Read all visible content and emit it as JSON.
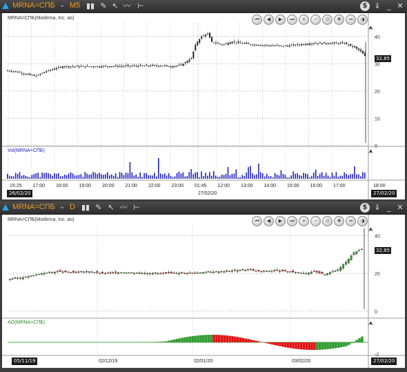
{
  "top_panel": {
    "symbol": "MRNA=СПБ",
    "timeframe": "M5",
    "instrument_label": "MRNA=СПБ(Moderna, Inc. ao)",
    "volume_label": "Vol(MRNA=СПБ)",
    "price_badge": "32,85",
    "start_date": "26/02/20",
    "end_date": "27/02/20"
  },
  "bottom_panel": {
    "symbol": "MRNA=СПБ",
    "timeframe": "D",
    "instrument_label": "MRNA=СПБ(Moderna, Inc. ao)",
    "ao_label": "AO(MRNA=СПБ)",
    "price_badge": "32,85",
    "start_date": "05/11/19",
    "end_date": "27/02/20"
  },
  "icons": {
    "toolbar": [
      "chevron-down-icon",
      "candles-icon",
      "pencil-icon",
      "cursor-icon",
      "lines-icon",
      "settings-icon"
    ],
    "right": [
      "dollar-icon",
      "pin-icon",
      "minimize-icon",
      "close-icon"
    ],
    "nav": [
      "scroll-begin-icon",
      "scroll-back-icon",
      "scroll-forward-icon",
      "scroll-end-icon",
      "zoom-in-icon",
      "zoom-out-icon",
      "zoom-fit-icon",
      "expand-icon",
      "shrink-icon",
      "autoscale-icon"
    ]
  },
  "colors": {
    "accent_title": "#f29a1c",
    "up": "#3a9a3a",
    "down": "#d02818",
    "volume": "#2020c0",
    "ao_line": "#4caf50"
  },
  "chart_data": [
    {
      "type": "candlestick",
      "title": "MRNA=СПБ(Moderna, Inc. ao)",
      "x_ticks": [
        "15:25",
        "17:00",
        "18:00",
        "19:00",
        "20:00",
        "21:00",
        "22:00",
        "23:00",
        "01:45",
        "12:00",
        "13:00",
        "14:00",
        "15:00",
        "16:00",
        "17:00",
        "18:00"
      ],
      "y_ticks": [
        "0",
        "10",
        "20",
        "30",
        "40"
      ],
      "ylim": [
        0,
        45
      ],
      "price_path": [
        [
          0,
          27.5
        ],
        [
          5,
          27
        ],
        [
          10,
          26
        ],
        [
          14,
          25.5
        ],
        [
          18,
          27
        ],
        [
          22,
          28
        ],
        [
          27,
          29
        ],
        [
          30,
          29
        ],
        [
          45,
          29
        ],
        [
          60,
          29.2
        ],
        [
          75,
          29.3
        ],
        [
          80,
          29
        ],
        [
          85,
          29.5
        ],
        [
          90,
          32
        ],
        [
          92,
          37
        ],
        [
          95,
          40
        ],
        [
          98,
          41
        ],
        [
          100,
          38
        ],
        [
          105,
          37
        ],
        [
          110,
          38
        ],
        [
          120,
          37
        ],
        [
          135,
          36.5
        ],
        [
          150,
          37.5
        ],
        [
          165,
          37.5
        ],
        [
          170,
          36
        ],
        [
          173,
          34.5
        ],
        [
          175,
          32.85
        ]
      ],
      "candle_count": 176,
      "last_price": 32.85,
      "grid": true
    },
    {
      "type": "bar",
      "title": "Vol(MRNA=СПБ)",
      "note": "volume bars, random-like heights with spikes near 17:00 and 01:45",
      "bar_count": 176
    },
    {
      "type": "candlestick",
      "title": "MRNA=СПБ(Moderna, Inc. ao)",
      "x_ticks": [
        "02/12/19",
        "02/01/20",
        "03/02/20"
      ],
      "y_ticks": [
        "0",
        "20",
        "40"
      ],
      "ylim": [
        -3,
        46
      ],
      "price_path": [
        [
          0,
          17
        ],
        [
          6,
          18
        ],
        [
          12,
          20
        ],
        [
          18,
          21
        ],
        [
          25,
          20.5
        ],
        [
          30,
          21
        ],
        [
          35,
          20
        ],
        [
          42,
          20.5
        ],
        [
          55,
          20
        ],
        [
          70,
          20.3
        ],
        [
          80,
          21
        ],
        [
          90,
          22
        ],
        [
          95,
          21
        ],
        [
          100,
          21.5
        ],
        [
          105,
          21
        ],
        [
          112,
          20
        ],
        [
          115,
          21
        ],
        [
          119,
          19.5
        ],
        [
          124,
          22
        ],
        [
          127,
          26
        ],
        [
          130,
          31
        ],
        [
          133,
          32.85
        ]
      ],
      "candle_count": 134,
      "last_price": 32.85,
      "grid": true
    },
    {
      "type": "bar",
      "title": "AO(MRNA=СПБ)",
      "y_ticks": [
        "-2"
      ],
      "note": "awesome oscillator histogram green/red"
    }
  ]
}
